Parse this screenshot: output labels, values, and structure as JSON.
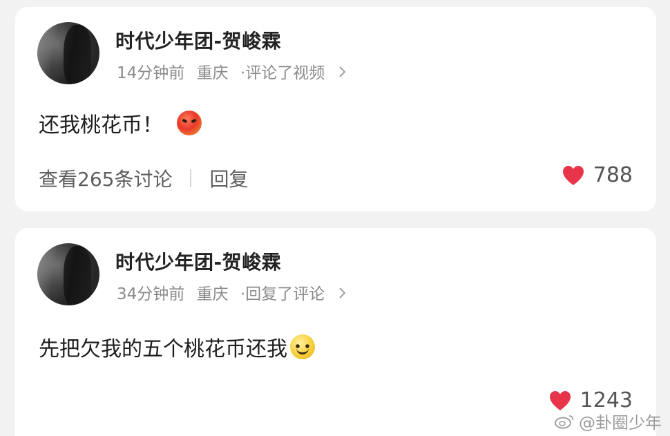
{
  "comments": [
    {
      "author": "时代少年团-贺峻霖",
      "time": "14分钟前",
      "location": "重庆",
      "action": "·评论了视频",
      "text": "还我桃花币！",
      "emoji": "angry-face-emoji",
      "discussion": "查看265条讨论",
      "reply": "回复",
      "likes": "788"
    },
    {
      "author": "时代少年团-贺峻霖",
      "time": "34分钟前",
      "location": "重庆",
      "action": "·回复了评论",
      "text": "先把欠我的五个桃花币还我",
      "emoji": "smile-face-emoji",
      "likes": "1243"
    }
  ],
  "watermark": "@卦圈少年",
  "colors": {
    "heart": "#e8344a",
    "background": "#f2f2f2",
    "card": "#ffffff",
    "meta": "#8a8a8a"
  }
}
